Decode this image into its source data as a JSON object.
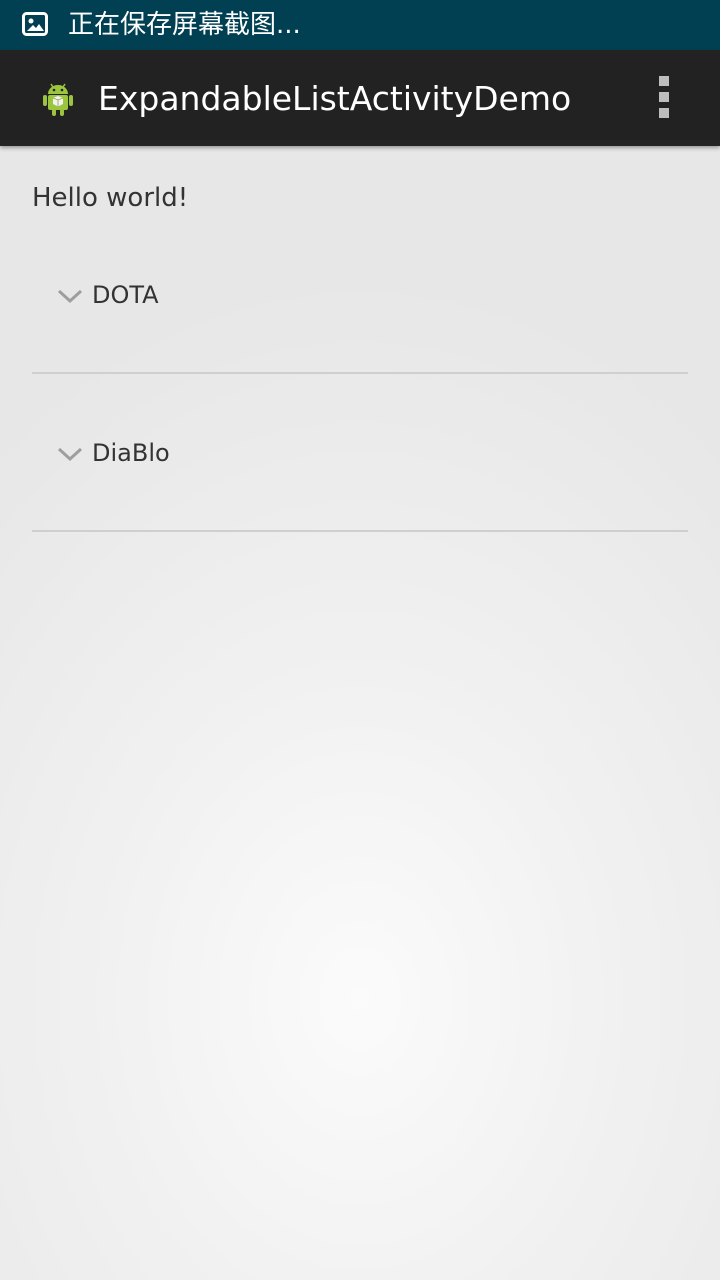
{
  "status_bar": {
    "notification_text": "正在保存屏幕截图...",
    "icon": "image-icon",
    "background_color": "#004052"
  },
  "action_bar": {
    "title": "ExpandableListActivityDemo",
    "app_icon": "android-robot-icon",
    "overflow_icon": "overflow-menu-icon",
    "background_color": "#222222"
  },
  "content": {
    "hello_text": "Hello world!",
    "groups": [
      {
        "label": "DOTA",
        "indicator": "chevron-down-icon"
      },
      {
        "label": "DiaBlo",
        "indicator": "chevron-down-icon"
      }
    ]
  }
}
